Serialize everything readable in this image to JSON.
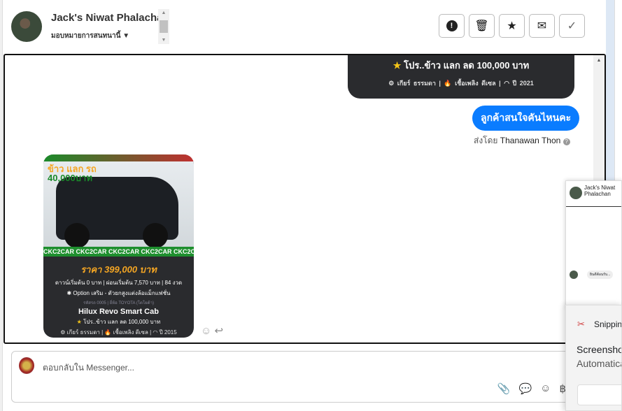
{
  "header": {
    "contact_name": "Jack's Niwat Phalachan",
    "assign_label": "มอบหมายการสนทนานี้"
  },
  "toolbar": {
    "spam": "!",
    "delete": "🗑",
    "star": "★",
    "unread": "✉",
    "done": "✓"
  },
  "messages": {
    "card_top": {
      "promo": "โปร..ข้าว แลก ลด 100,000 บาท",
      "spec": "⚙ เกียร์ ธรรมดา | 🔥 เชื้อเพลิง ดีเซล | ◠ ปี 2021"
    },
    "outgoing": {
      "text": "ลูกค้าสนใจคันไหนคะ",
      "sent_by_prefix": "ส่งโดย",
      "sent_by_name": "Thanawan Thon"
    },
    "image_card": {
      "ad_top": "ข้าว แลก รถ",
      "ad_amount": "40,000บาท",
      "banner": "CKC2CAR CKC2CAR CKC2CAR CKC2CAR CKC2CAR",
      "price": "ราคา 399,000 บาท",
      "terms": "ดาวน์เริ่มต้น 0 บาท | ผ่อนเริ่มต้น 7,570 บาท | 84 งวด",
      "option": "✱ Option เสริม - ตัวยกสูงแต่งล้อแม็กแฟชั่น",
      "meta": "รหัสรถ 0005 | ยี่ห้อ TOYOTA (โตโยต้า)",
      "model": "Hilux Revo Smart Cab",
      "promo": "โปร..ข้าว แลก ลด 100,000 บาท",
      "spec": "⚙ เกียร์ ธรรมดา | 🔥 เชื้อเพลิง ดีเซล | ◠ ปี 2015"
    }
  },
  "composer": {
    "placeholder": "ตอบกลับใน Messenger..."
  },
  "mini_window": {
    "name": "Jack's Niwat Phalachan",
    "message": "ยินดีต้อนรับ..."
  },
  "toast": {
    "app": "Snipping Tool",
    "title": "Screenshot copied",
    "subtitle": "Automatically saved"
  }
}
